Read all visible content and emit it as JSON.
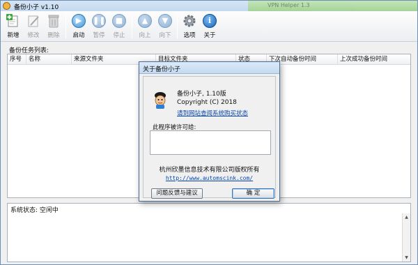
{
  "app": {
    "title": "备份小子 v1.10",
    "background_window_title": "VPN Helper 1.3"
  },
  "toolbar": {
    "new": "新增",
    "edit": "修改",
    "delete": "删除",
    "start": "启动",
    "pause": "暂停",
    "stop": "停止",
    "up": "向上",
    "down": "向下",
    "options": "选项",
    "about": "关于"
  },
  "task_list": {
    "label": "备份任务列表:",
    "columns": [
      "序号",
      "名称",
      "来源文件夹",
      "目标文件夹",
      "状态",
      "下次自动备份时间",
      "上次成功备份时间"
    ]
  },
  "status": {
    "text": "系统状态: 空闲中"
  },
  "about_dialog": {
    "title": "关于备份小子",
    "product": "备份小子, 1.10版",
    "copyright": "Copyright (C) 2018",
    "purchase_link": "请到网站查阅系统购买状态",
    "license_label": "此程序被许可给:",
    "company": "杭州欣墨信息技术有限公司版权所有",
    "website": "http://www.automscink.com/",
    "feedback_button": "问题反馈与建议",
    "ok_button": "确 定"
  },
  "colors": {
    "accent": "#3f95d6",
    "link": "#0645ad",
    "green": "#3aa63a",
    "title_bar": "#c4d9ef"
  }
}
